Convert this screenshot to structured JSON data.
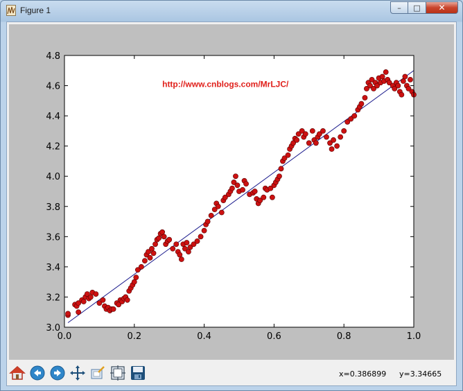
{
  "window": {
    "title": "Figure 1",
    "minimize_symbol": "–",
    "maximize_symbol": "□",
    "close_symbol": "✕"
  },
  "colors": {
    "figure_bg": "#bfbfbf",
    "axes_bg": "#ffffff",
    "point_fill": "#cc1111",
    "point_edge": "#550000",
    "fit_line": "#1a1a8c",
    "annotation": "#e0201b"
  },
  "toolbar": {
    "buttons": [
      {
        "name": "home-icon"
      },
      {
        "name": "back-icon"
      },
      {
        "name": "forward-icon"
      },
      {
        "name": "pan-icon"
      },
      {
        "name": "zoom-icon"
      },
      {
        "name": "subplots-icon"
      },
      {
        "name": "save-icon"
      }
    ],
    "status_x": "x=0.386899",
    "status_y": "y=3.34665"
  },
  "chart_data": {
    "type": "scatter",
    "title": "",
    "xlabel": "",
    "ylabel": "",
    "xlim": [
      0.0,
      1.0
    ],
    "ylim": [
      3.0,
      4.8
    ],
    "x_ticks": [
      "0.0",
      "0.2",
      "0.4",
      "0.6",
      "0.8",
      "1.0"
    ],
    "y_ticks": [
      "3.0",
      "3.2",
      "3.4",
      "3.6",
      "3.8",
      "4.0",
      "4.2",
      "4.4",
      "4.6",
      "4.8"
    ],
    "annotation": "http://www.cnblogs.com/MrLJC/",
    "grid": false,
    "fit_line": {
      "x": [
        0.01,
        1.0
      ],
      "y": [
        3.03,
        4.7
      ]
    },
    "series": [
      {
        "points": [
          [
            0.01,
            3.08
          ],
          [
            0.01,
            3.09
          ],
          [
            0.03,
            3.15
          ],
          [
            0.035,
            3.14
          ],
          [
            0.04,
            3.16
          ],
          [
            0.04,
            3.1
          ],
          [
            0.05,
            3.18
          ],
          [
            0.055,
            3.17
          ],
          [
            0.06,
            3.2
          ],
          [
            0.065,
            3.22
          ],
          [
            0.07,
            3.19
          ],
          [
            0.075,
            3.2
          ],
          [
            0.08,
            3.23
          ],
          [
            0.09,
            3.22
          ],
          [
            0.1,
            3.16
          ],
          [
            0.11,
            3.18
          ],
          [
            0.115,
            3.14
          ],
          [
            0.12,
            3.12
          ],
          [
            0.125,
            3.13
          ],
          [
            0.13,
            3.11
          ],
          [
            0.135,
            3.12
          ],
          [
            0.14,
            3.12
          ],
          [
            0.15,
            3.16
          ],
          [
            0.155,
            3.15
          ],
          [
            0.16,
            3.18
          ],
          [
            0.165,
            3.17
          ],
          [
            0.17,
            3.19
          ],
          [
            0.175,
            3.2
          ],
          [
            0.18,
            3.18
          ],
          [
            0.185,
            3.24
          ],
          [
            0.19,
            3.26
          ],
          [
            0.195,
            3.28
          ],
          [
            0.2,
            3.3
          ],
          [
            0.205,
            3.33
          ],
          [
            0.21,
            3.38
          ],
          [
            0.22,
            3.4
          ],
          [
            0.23,
            3.44
          ],
          [
            0.235,
            3.48
          ],
          [
            0.24,
            3.5
          ],
          [
            0.245,
            3.46
          ],
          [
            0.25,
            3.52
          ],
          [
            0.255,
            3.49
          ],
          [
            0.26,
            3.55
          ],
          [
            0.265,
            3.58
          ],
          [
            0.27,
            3.59
          ],
          [
            0.275,
            3.62
          ],
          [
            0.28,
            3.63
          ],
          [
            0.285,
            3.6
          ],
          [
            0.29,
            3.55
          ],
          [
            0.295,
            3.57
          ],
          [
            0.3,
            3.58
          ],
          [
            0.31,
            3.52
          ],
          [
            0.32,
            3.55
          ],
          [
            0.325,
            3.5
          ],
          [
            0.33,
            3.48
          ],
          [
            0.335,
            3.45
          ],
          [
            0.34,
            3.55
          ],
          [
            0.345,
            3.52
          ],
          [
            0.35,
            3.56
          ],
          [
            0.355,
            3.5
          ],
          [
            0.36,
            3.53
          ],
          [
            0.37,
            3.55
          ],
          [
            0.38,
            3.57
          ],
          [
            0.39,
            3.6
          ],
          [
            0.4,
            3.64
          ],
          [
            0.405,
            3.68
          ],
          [
            0.41,
            3.7
          ],
          [
            0.42,
            3.74
          ],
          [
            0.43,
            3.78
          ],
          [
            0.435,
            3.82
          ],
          [
            0.44,
            3.8
          ],
          [
            0.45,
            3.76
          ],
          [
            0.455,
            3.84
          ],
          [
            0.46,
            3.86
          ],
          [
            0.47,
            3.88
          ],
          [
            0.475,
            3.9
          ],
          [
            0.48,
            3.92
          ],
          [
            0.485,
            3.96
          ],
          [
            0.49,
            4.0
          ],
          [
            0.495,
            3.94
          ],
          [
            0.5,
            3.9
          ],
          [
            0.51,
            3.91
          ],
          [
            0.515,
            3.97
          ],
          [
            0.52,
            3.95
          ],
          [
            0.53,
            3.88
          ],
          [
            0.54,
            3.89
          ],
          [
            0.545,
            3.9
          ],
          [
            0.55,
            3.85
          ],
          [
            0.555,
            3.82
          ],
          [
            0.56,
            3.84
          ],
          [
            0.57,
            3.86
          ],
          [
            0.575,
            3.92
          ],
          [
            0.58,
            3.91
          ],
          [
            0.59,
            3.92
          ],
          [
            0.595,
            3.86
          ],
          [
            0.6,
            3.94
          ],
          [
            0.605,
            3.96
          ],
          [
            0.61,
            3.98
          ],
          [
            0.615,
            4.0
          ],
          [
            0.62,
            4.05
          ],
          [
            0.625,
            4.1
          ],
          [
            0.63,
            4.12
          ],
          [
            0.64,
            4.14
          ],
          [
            0.645,
            4.18
          ],
          [
            0.65,
            4.2
          ],
          [
            0.655,
            4.22
          ],
          [
            0.66,
            4.25
          ],
          [
            0.665,
            4.24
          ],
          [
            0.67,
            4.28
          ],
          [
            0.68,
            4.3
          ],
          [
            0.685,
            4.26
          ],
          [
            0.69,
            4.28
          ],
          [
            0.7,
            4.22
          ],
          [
            0.71,
            4.3
          ],
          [
            0.715,
            4.24
          ],
          [
            0.72,
            4.22
          ],
          [
            0.725,
            4.26
          ],
          [
            0.73,
            4.28
          ],
          [
            0.74,
            4.3
          ],
          [
            0.75,
            4.26
          ],
          [
            0.76,
            4.22
          ],
          [
            0.765,
            4.18
          ],
          [
            0.77,
            4.24
          ],
          [
            0.78,
            4.2
          ],
          [
            0.79,
            4.26
          ],
          [
            0.8,
            4.3
          ],
          [
            0.81,
            4.36
          ],
          [
            0.82,
            4.38
          ],
          [
            0.83,
            4.4
          ],
          [
            0.84,
            4.44
          ],
          [
            0.845,
            4.46
          ],
          [
            0.85,
            4.48
          ],
          [
            0.86,
            4.52
          ],
          [
            0.865,
            4.58
          ],
          [
            0.87,
            4.62
          ],
          [
            0.875,
            4.6
          ],
          [
            0.88,
            4.64
          ],
          [
            0.885,
            4.58
          ],
          [
            0.89,
            4.62
          ],
          [
            0.895,
            4.6
          ],
          [
            0.9,
            4.65
          ],
          [
            0.905,
            4.62
          ],
          [
            0.91,
            4.66
          ],
          [
            0.915,
            4.63
          ],
          [
            0.92,
            4.69
          ],
          [
            0.925,
            4.64
          ],
          [
            0.93,
            4.62
          ],
          [
            0.94,
            4.6
          ],
          [
            0.945,
            4.58
          ],
          [
            0.95,
            4.62
          ],
          [
            0.955,
            4.6
          ],
          [
            0.96,
            4.56
          ],
          [
            0.965,
            4.54
          ],
          [
            0.97,
            4.63
          ],
          [
            0.975,
            4.66
          ],
          [
            0.98,
            4.6
          ],
          [
            0.985,
            4.58
          ],
          [
            0.99,
            4.64
          ],
          [
            0.995,
            4.56
          ],
          [
            1.0,
            4.54
          ]
        ]
      }
    ]
  }
}
